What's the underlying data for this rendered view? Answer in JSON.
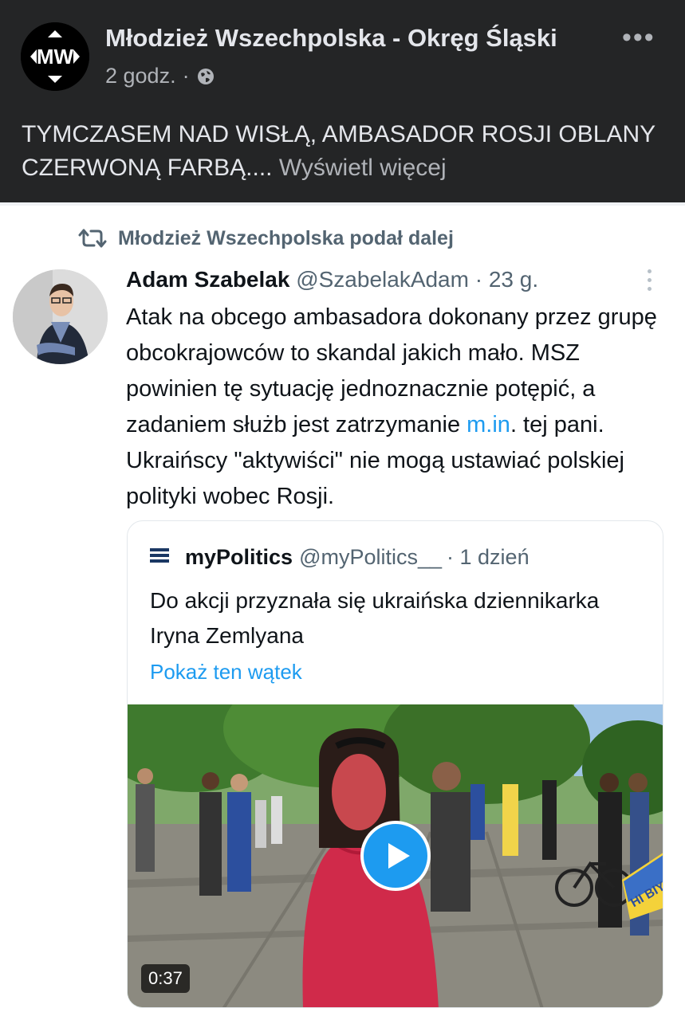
{
  "post": {
    "author": "Młodzież Wszechpolska - Okręg Śląski",
    "time": "2 godz.",
    "separator": "·",
    "privacy_icon": "globe-icon",
    "more_icon": "•••",
    "text": "TYMCZASEM NAD WISŁĄ, AMBASADOR ROSJI OBLANY CZERWONĄ FARBĄ....",
    "see_more": "Wyświetl więcej",
    "avatar_logo": "MW"
  },
  "tweet": {
    "retweet_label": "Młodzież Wszechpolska podał dalej",
    "author": "Adam Szabelak",
    "handle": "@SzabelakAdam",
    "time": "· 23 g.",
    "body_before": "Atak na obcego ambasadora dokonany przez grupę obcokrajowców to skandal jakich mało. MSZ powinien tę sytuację jednoznacznie potępić, a zadaniem służb jest zatrzymanie ",
    "body_link": "m.in",
    "body_after": ". tej pani. Ukraińscy \"aktywiści\" nie mogą ustawiać polskiej polityki wobec Rosji."
  },
  "quote": {
    "author": "myPolitics",
    "handle": "@myPolitics__",
    "time": "· 1 dzień",
    "body": "Do akcji przyznała się ukraińska dziennikarka Iryna Zemlyana",
    "show_thread": "Pokaż ten wątek",
    "video_duration": "0:37",
    "sign_text": "HI BIY"
  },
  "colors": {
    "fb_bg": "#242526",
    "fb_text": "#e4e6eb",
    "fb_secondary": "#b0b3b8",
    "twitter_blue": "#1d9bf0",
    "tweet_text": "#0f1419",
    "tweet_secondary": "#536471"
  }
}
